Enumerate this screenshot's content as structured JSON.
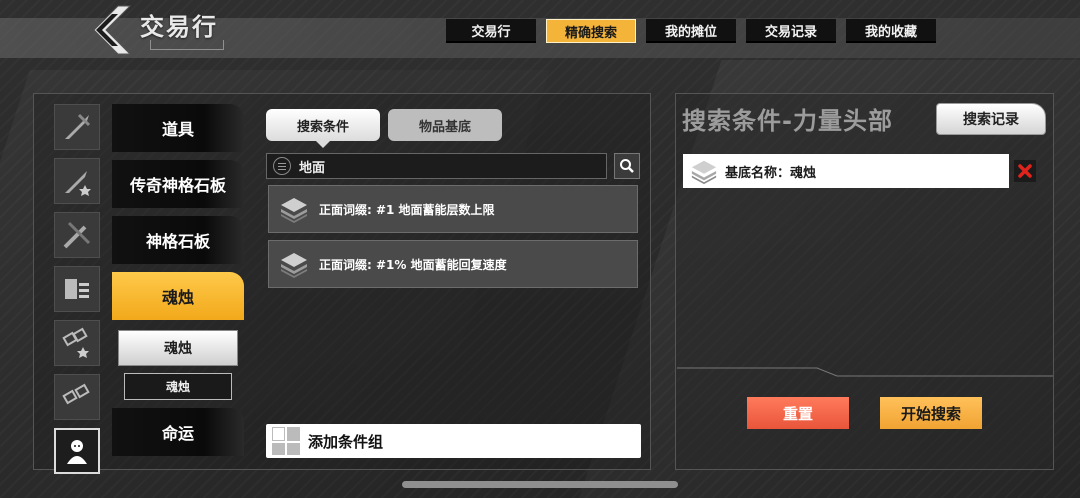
{
  "header": {
    "title": "交易行",
    "tabs": [
      {
        "label": "交易行",
        "active": false
      },
      {
        "label": "精确搜索",
        "active": true
      },
      {
        "label": "我的摊位",
        "active": false
      },
      {
        "label": "交易记录",
        "active": false
      },
      {
        "label": "我的收藏",
        "active": false
      }
    ]
  },
  "sidebar": {
    "icons": [
      "sword-slash-icon",
      "sword-star-icon",
      "sword-cross-icon",
      "card-stack-icon",
      "link-star-icon",
      "link-icon",
      "ghost-portrait-icon"
    ],
    "categories": [
      {
        "label": "道具",
        "active": false
      },
      {
        "label": "传奇神格石板",
        "active": false
      },
      {
        "label": "神格石板",
        "active": false
      },
      {
        "label": "魂烛",
        "active": true
      },
      {
        "label": "命运",
        "active": false
      }
    ],
    "sub_primary": "魂烛",
    "sub_secondary": "魂烛"
  },
  "search": {
    "tab_conditions": "搜索条件",
    "tab_base": "物品基底",
    "query": "地面",
    "results": [
      {
        "text": "正面词缀: #1 地面蓄能层数上限"
      },
      {
        "text": "正面词缀: #1% 地面蓄能回复速度"
      }
    ],
    "add_group_label": "添加条件组"
  },
  "right_panel": {
    "title": "搜索条件-力量头部",
    "history_label": "搜索记录",
    "condition": "基底名称：魂烛",
    "reset_label": "重置",
    "start_label": "开始搜索"
  },
  "colors": {
    "accent": "#f4b43a",
    "reset": "#e9553a",
    "delete": "#e0231c"
  }
}
